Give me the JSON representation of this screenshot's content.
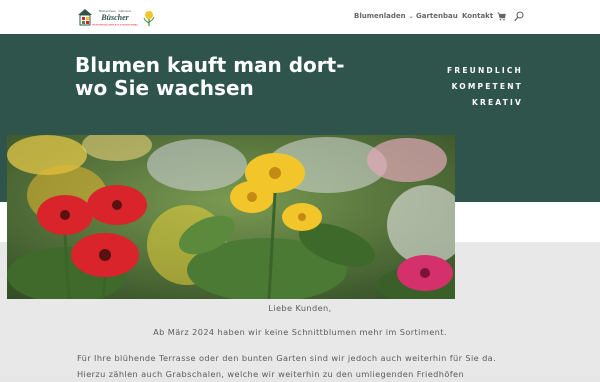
{
  "header": {
    "logo": {
      "line1": "Blumenhaus · Gärtnerei",
      "name": "Büscher",
      "tagline": "FRÜHJAHRSBLÜHER AUS EIGENEM ANBAU"
    },
    "nav": [
      {
        "label": "Blumenladen",
        "has_dropdown": true
      },
      {
        "label": "Gartenbau"
      },
      {
        "label": "Kontakt"
      }
    ],
    "icons": [
      "cart-icon",
      "search-icon"
    ]
  },
  "hero": {
    "title": "Blumen kauft man dort- wo Sie wachsen",
    "taglines": [
      "FREUNDLICH",
      "KOMPETENT",
      "KREATIV"
    ]
  },
  "content": {
    "greeting": "Liebe Kunden,",
    "notice": "Ab März 2024 haben wir keine Schnittblumen mehr im Sortiment.",
    "paragraph": "Für Ihre blühende Terrasse oder den bunten Garten sind wir jedoch auch weiterhin für Sie da. Hierzu zählen auch Grabschalen, welche wir weiterhin zu den umliegenden Friedhöfen"
  },
  "colors": {
    "hero_bg": "#2e544c",
    "header_bg": "#ffffff",
    "accent_yellow": "#f2c62a",
    "accent_red": "#d8242a"
  }
}
